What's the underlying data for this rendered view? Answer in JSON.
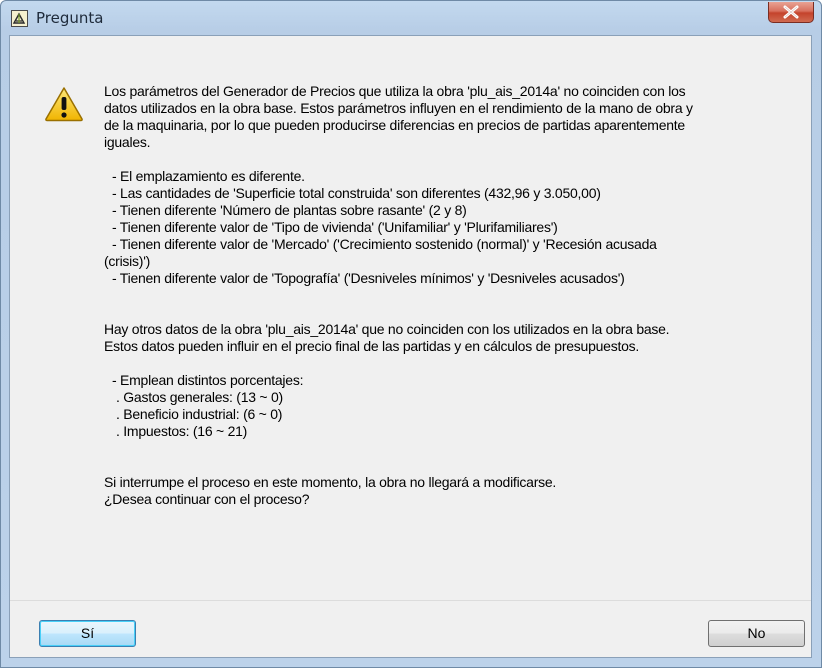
{
  "window": {
    "title": "Pregunta",
    "app_icon": "app-icon",
    "close_icon": "close-icon"
  },
  "message": {
    "icon": "warning-icon",
    "intro_lines": [
      "Los parámetros del Generador de Precios que utiliza la obra 'plu_ais_2014a' no coinciden con los",
      "datos utilizados en la obra base. Estos parámetros influyen en el rendimiento de la mano de obra y",
      "de la maquinaria, por lo que pueden producirse diferencias en precios de partidas aparentemente",
      "iguales."
    ],
    "differences": [
      "- El emplazamiento es diferente.",
      "- Las cantidades de 'Superficie total construida' son diferentes (432,96 y 3.050,00)",
      "- Tienen diferente 'Número de plantas sobre rasante' (2 y 8)",
      "- Tienen diferente valor de 'Tipo de vivienda' ('Unifamiliar' y 'Plurifamiliares')",
      "- Tienen diferente valor de 'Mercado' ('Crecimiento sostenido (normal)' y 'Recesión acusada",
      "(crisis)')",
      "- Tienen diferente valor de 'Topografía' ('Desniveles mínimos' y 'Desniveles acusados')"
    ],
    "other_lines": [
      "Hay otros datos de la obra 'plu_ais_2014a' que no coinciden con los utilizados en la obra base.",
      "Estos datos pueden influir en el precio final de las partidas y en cálculos de presupuestos."
    ],
    "percentages": [
      "- Emplean distintos porcentajes:",
      ". Gastos generales: (13 ~ 0)",
      ". Beneficio industrial: (6 ~ 0)",
      ". Impuestos: (16 ~ 21)"
    ],
    "closing_lines": [
      "Si interrumpe el proceso en este momento, la obra no llegará a modificarse.",
      "¿Desea continuar con el proceso?"
    ]
  },
  "buttons": {
    "yes_label": "Sí",
    "no_label": "No"
  },
  "colors": {
    "close_button": "#c4432c",
    "warning_fill": "#f5c518",
    "default_button_border": "#3c7fb1"
  }
}
